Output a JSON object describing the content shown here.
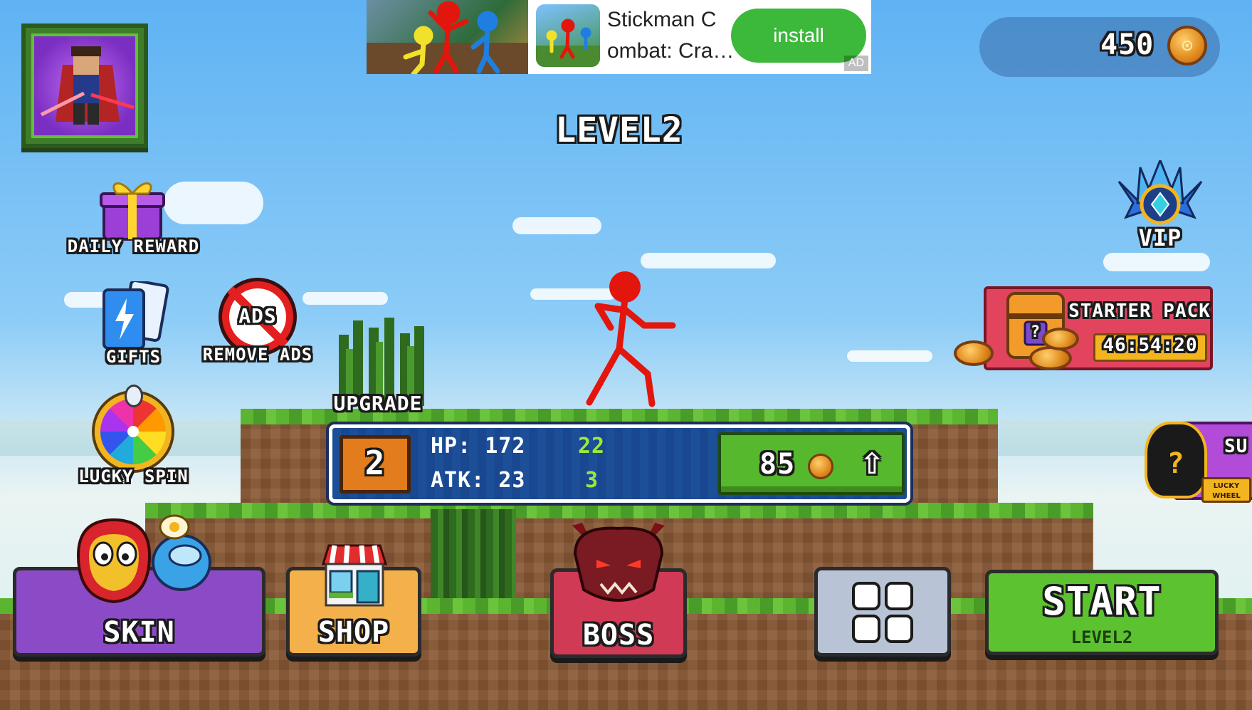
{
  "ad": {
    "title": "Stickman Combat: Cra…",
    "title_line1": "Stickman C",
    "title_line2": "ombat: Cra…",
    "install_label": "install",
    "badge": "AD"
  },
  "currency": {
    "coins": "450",
    "icon": "gold-coin-icon"
  },
  "level_title": "LEVEL2",
  "left_menu": {
    "daily_reward": "DAILY REWARD",
    "gifts": "GIFTS",
    "remove_ads": "REMOVE ADS",
    "remove_ads_icon_text": "ADS",
    "lucky_spin": "LUCKY SPIN"
  },
  "right_menu": {
    "vip": "VIP",
    "starter_pack": {
      "title": "STARTER PACK",
      "timer": "46:54:20",
      "chest_mark": "?"
    },
    "lucky_wheel": {
      "label_partial": "SU",
      "badge": "LUCKY WHEEL",
      "mark": "?"
    }
  },
  "upgrade": {
    "label": "UPGRADE",
    "level": "2",
    "hp_label": "HP: 172",
    "hp_gain": "22",
    "atk_label": "ATK: 23",
    "atk_gain": "3",
    "cost": "85",
    "arrow": "⇧"
  },
  "bottom_bar": {
    "skin": "SKIN",
    "shop": "SHOP",
    "boss": "BOSS",
    "start": "START",
    "start_level": "LEVEL2"
  },
  "colors": {
    "sky": "#7cc4f5",
    "grass": "#5bb531",
    "dirt": "#8a5a36",
    "skin_btn": "#8c4bc6",
    "shop_btn": "#f4b04a",
    "boss_btn": "#d13a54",
    "menu_btn": "#b9c3d6",
    "start_btn": "#5cc22f",
    "stickman": "#e3160e"
  }
}
